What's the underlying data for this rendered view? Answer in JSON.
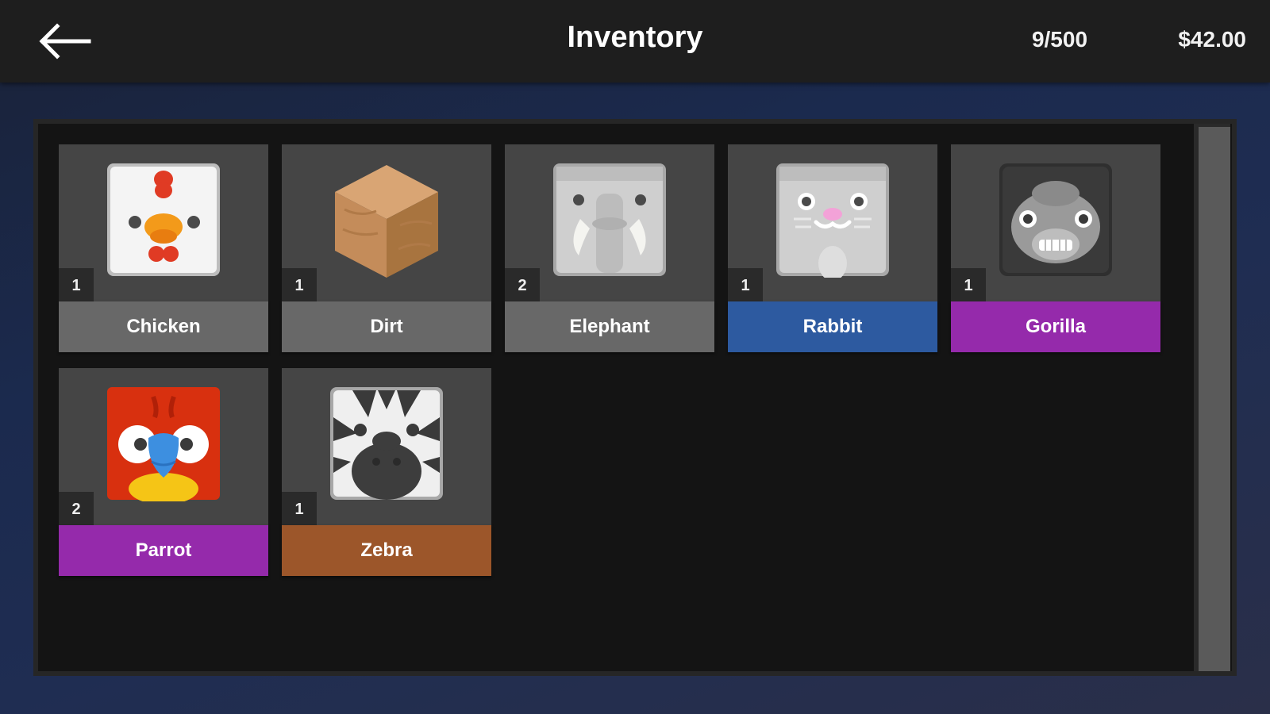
{
  "header": {
    "title": "Inventory",
    "capacity": "9/500",
    "money": "$42.00",
    "back_icon": "back-arrow-icon"
  },
  "rarity_colors": {
    "common": "#686868",
    "rare": "#2d5aa0",
    "epic": "#952aab",
    "legendary": "#9c562a"
  },
  "items": [
    {
      "name": "Chicken",
      "count": "1",
      "rarity": "common",
      "icon": "chicken-icon"
    },
    {
      "name": "Dirt",
      "count": "1",
      "rarity": "common",
      "icon": "dirt-block-icon"
    },
    {
      "name": "Elephant",
      "count": "2",
      "rarity": "common",
      "icon": "elephant-icon"
    },
    {
      "name": "Rabbit",
      "count": "1",
      "rarity": "rare",
      "icon": "rabbit-icon"
    },
    {
      "name": "Gorilla",
      "count": "1",
      "rarity": "epic",
      "icon": "gorilla-icon"
    },
    {
      "name": "Parrot",
      "count": "2",
      "rarity": "epic",
      "icon": "parrot-icon"
    },
    {
      "name": "Zebra",
      "count": "1",
      "rarity": "legendary",
      "icon": "zebra-icon"
    }
  ]
}
